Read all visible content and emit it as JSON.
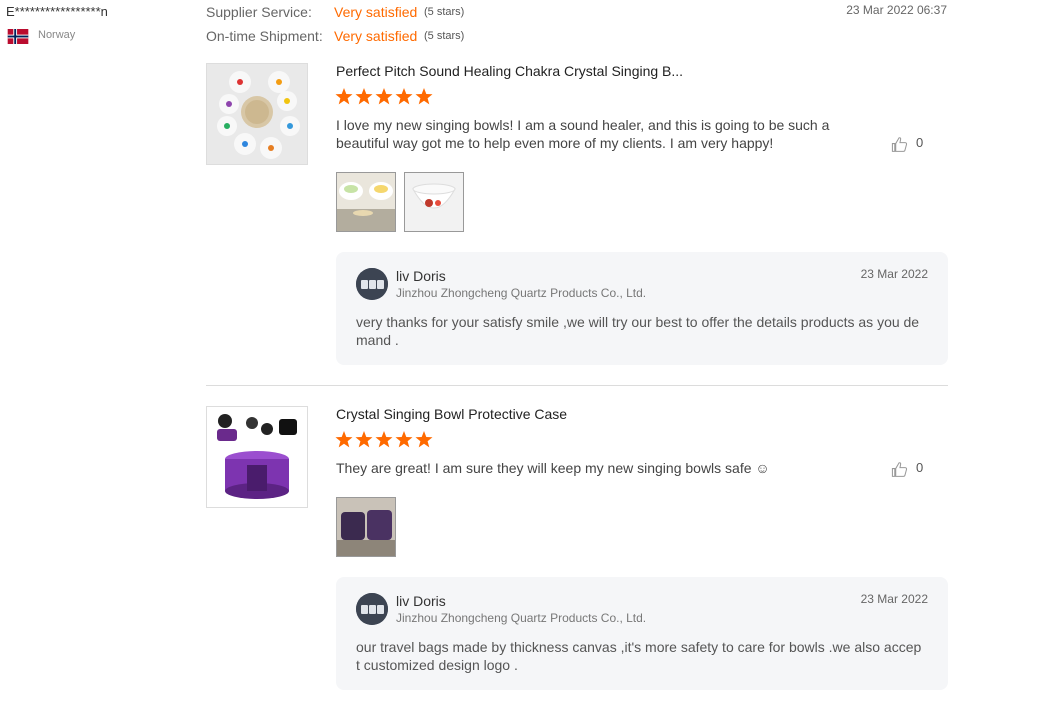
{
  "buyer": {
    "name": "E*****************n",
    "country": "Norway",
    "flag_icon": "norway-flag-icon"
  },
  "ratings": [
    {
      "label": "Supplier Service:",
      "value": "Very satisfied",
      "stars": "(5 stars)"
    },
    {
      "label": "On-time Shipment:",
      "value": "Very satisfied",
      "stars": "(5 stars)"
    }
  ],
  "timestamp": "23 Mar 2022 06:37",
  "reviews": [
    {
      "title": "Perfect Pitch Sound Healing Chakra Crystal Singing B...",
      "rating": 5,
      "text": "I love my new singing bowls! I am a sound healer, and this is going to be such a beautiful way got me to help even more of my clients. I am very happy!",
      "likes": "0",
      "reply": {
        "name": "liv Doris",
        "company": "Jinzhou Zhongcheng Quartz Products Co., Ltd.",
        "date": "23 Mar 2022",
        "text": "very thanks for your satisfy smile ,we will try our best to offer the details products as you demand ."
      }
    },
    {
      "title": "Crystal Singing Bowl Protective Case",
      "rating": 5,
      "text": "They are great! I am sure they will keep my new singing bowls safe ☺",
      "likes": "0",
      "reply": {
        "name": "liv Doris",
        "company": "Jinzhou Zhongcheng Quartz Products Co., Ltd.",
        "date": "23 Mar 2022",
        "text": "our travel bags made by thickness canvas ,it's more safety to care for bowls .we also accept customized design logo ."
      }
    }
  ],
  "colors": {
    "accent": "#ff6a00",
    "star": "#ff6a00",
    "reply_bg": "#f5f6f8"
  }
}
